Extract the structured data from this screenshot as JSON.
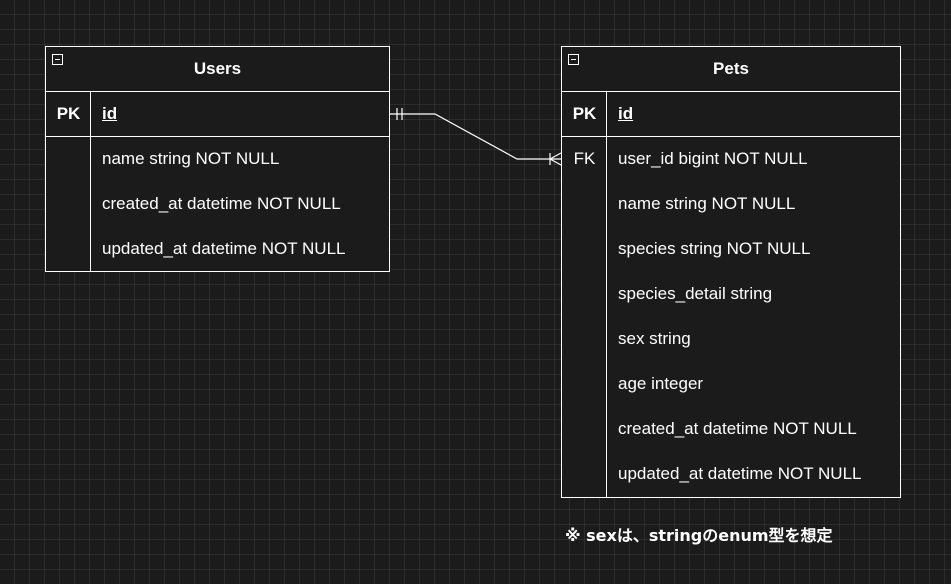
{
  "users": {
    "title": "Users",
    "pk_label": "PK",
    "pk_field": "id",
    "fields": [
      "name string NOT NULL",
      "created_at datetime NOT NULL",
      "updated_at datetime NOT NULL"
    ]
  },
  "pets": {
    "title": "Pets",
    "pk_label": "PK",
    "pk_field": "id",
    "fk_label": "FK",
    "fields": [
      "user_id bigint NOT NULL",
      "name string NOT NULL",
      "species string NOT NULL",
      "species_detail string",
      "sex string",
      "age integer",
      "created_at datetime NOT NULL",
      "updated_at datetime NOT NULL"
    ]
  },
  "relationship": {
    "from": "Users",
    "to": "Pets",
    "from_cardinality": "one-and-only-one",
    "to_cardinality": "one-or-many"
  },
  "footnote": "※ sexは、stringのenum型を想定",
  "colors": {
    "background": "#1b1b1b",
    "line": "#ffffff",
    "text": "#ffffff"
  }
}
